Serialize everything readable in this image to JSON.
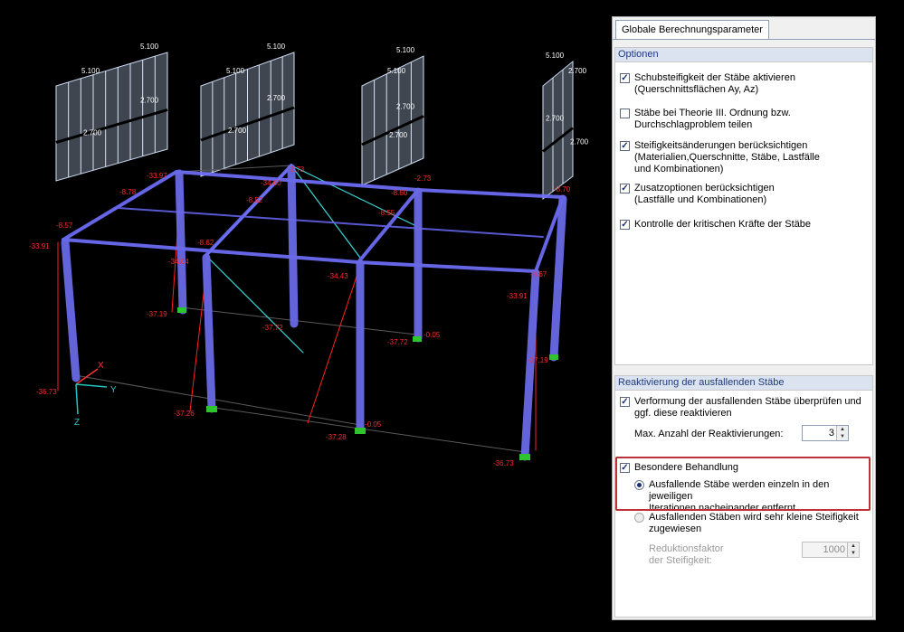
{
  "viewport": {
    "load_values": [
      "5.100",
      "5.100",
      "5.100",
      "5.100",
      "5.100",
      "5.100",
      "5.100",
      "2.700",
      "2.700",
      "2.700",
      "2.700",
      "2.700",
      "2.700",
      "2.700",
      "2.700"
    ],
    "moment_labels": [
      "-33.97",
      "-8.78",
      "-8.57",
      "-33.91",
      "-34.04",
      "-8.62",
      "-8.52",
      "-34.60",
      "-2.73",
      "-8.60",
      "-2.73",
      "-34.43",
      "-8.55",
      "-8.70",
      "-33.91",
      "-8.67"
    ],
    "support_labels": [
      "-37.19",
      "-36.73",
      "-37.26",
      "-37.72",
      "-37.72",
      "-0.05",
      "-37.28",
      "-0.05",
      "-37.19",
      "-36.73"
    ],
    "axes": {
      "x": "X",
      "y": "Y",
      "z": "Z"
    }
  },
  "panel": {
    "tab": "Globale Berechnungsparameter",
    "options": {
      "title": "Optionen",
      "items": [
        {
          "label": "Schubsteifigkeit der Stäbe aktivieren",
          "sub": "(Querschnittsflächen Ay, Az)",
          "checked": true
        },
        {
          "label": "Stäbe bei Theorie III. Ordnung bzw.",
          "sub": "Durchschlagproblem teilen",
          "checked": false
        },
        {
          "label": "Steifigkeitsänderungen berücksichtigen",
          "sub": "(Materialien,Querschnitte, Stäbe, Lastfälle",
          "sub2": "und Kombinationen)",
          "checked": true
        },
        {
          "label": "Zusatzoptionen berücksichtigen",
          "sub": "(Lastfälle und Kombinationen)",
          "checked": true
        },
        {
          "label": "Kontrolle der kritischen Kräfte der Stäbe",
          "checked": true
        }
      ]
    },
    "reactivation": {
      "title": "Reaktivierung der ausfallenden Stäbe",
      "check_label": "Verformung der ausfallenden Stäbe überprüfen und",
      "check_sub": "ggf. diese reaktivieren",
      "max_label": "Max. Anzahl der Reaktivierungen:",
      "max_value": "3",
      "special_label": "Besondere Behandlung",
      "radio1": "Ausfallende Stäbe werden einzeln in den jeweiligen",
      "radio1_sub": "Iterationen nacheinander entfernt",
      "radio2": "Ausfallenden Stäben wird sehr kleine Steifigkeit",
      "radio2_sub": "zugewiesen",
      "factor_label": "Reduktionsfaktor",
      "factor_sub": "der Steifigkeit:",
      "factor_value": "1000"
    }
  }
}
